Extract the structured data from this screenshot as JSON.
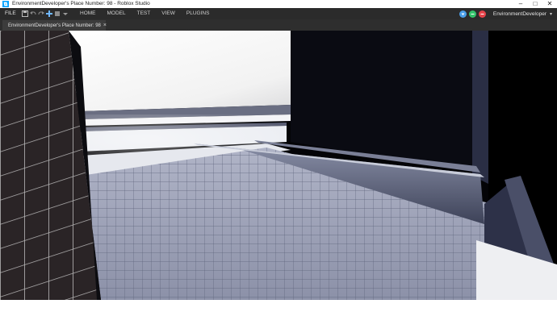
{
  "window": {
    "title": "EnvironmentDeveloper's Place Number: 98 - Roblox Studio",
    "controls": {
      "minimize": "–",
      "maximize": "□",
      "close": "✕"
    }
  },
  "menu": {
    "file_label": "FILE",
    "tabs": [
      "HOME",
      "MODEL",
      "TEST",
      "VIEW",
      "PLUGINS"
    ],
    "user_name": "EnvironmentDeveloper",
    "user_caret": "▾"
  },
  "document_tab": {
    "label": "EnvironmentDeveloper's Place Number: 98",
    "close": "×"
  },
  "colors": {
    "menubar_bg": "#2b2b2b",
    "accent_blue": "#4a9ee8",
    "status_green": "#33c26a",
    "status_red": "#e5434a"
  }
}
